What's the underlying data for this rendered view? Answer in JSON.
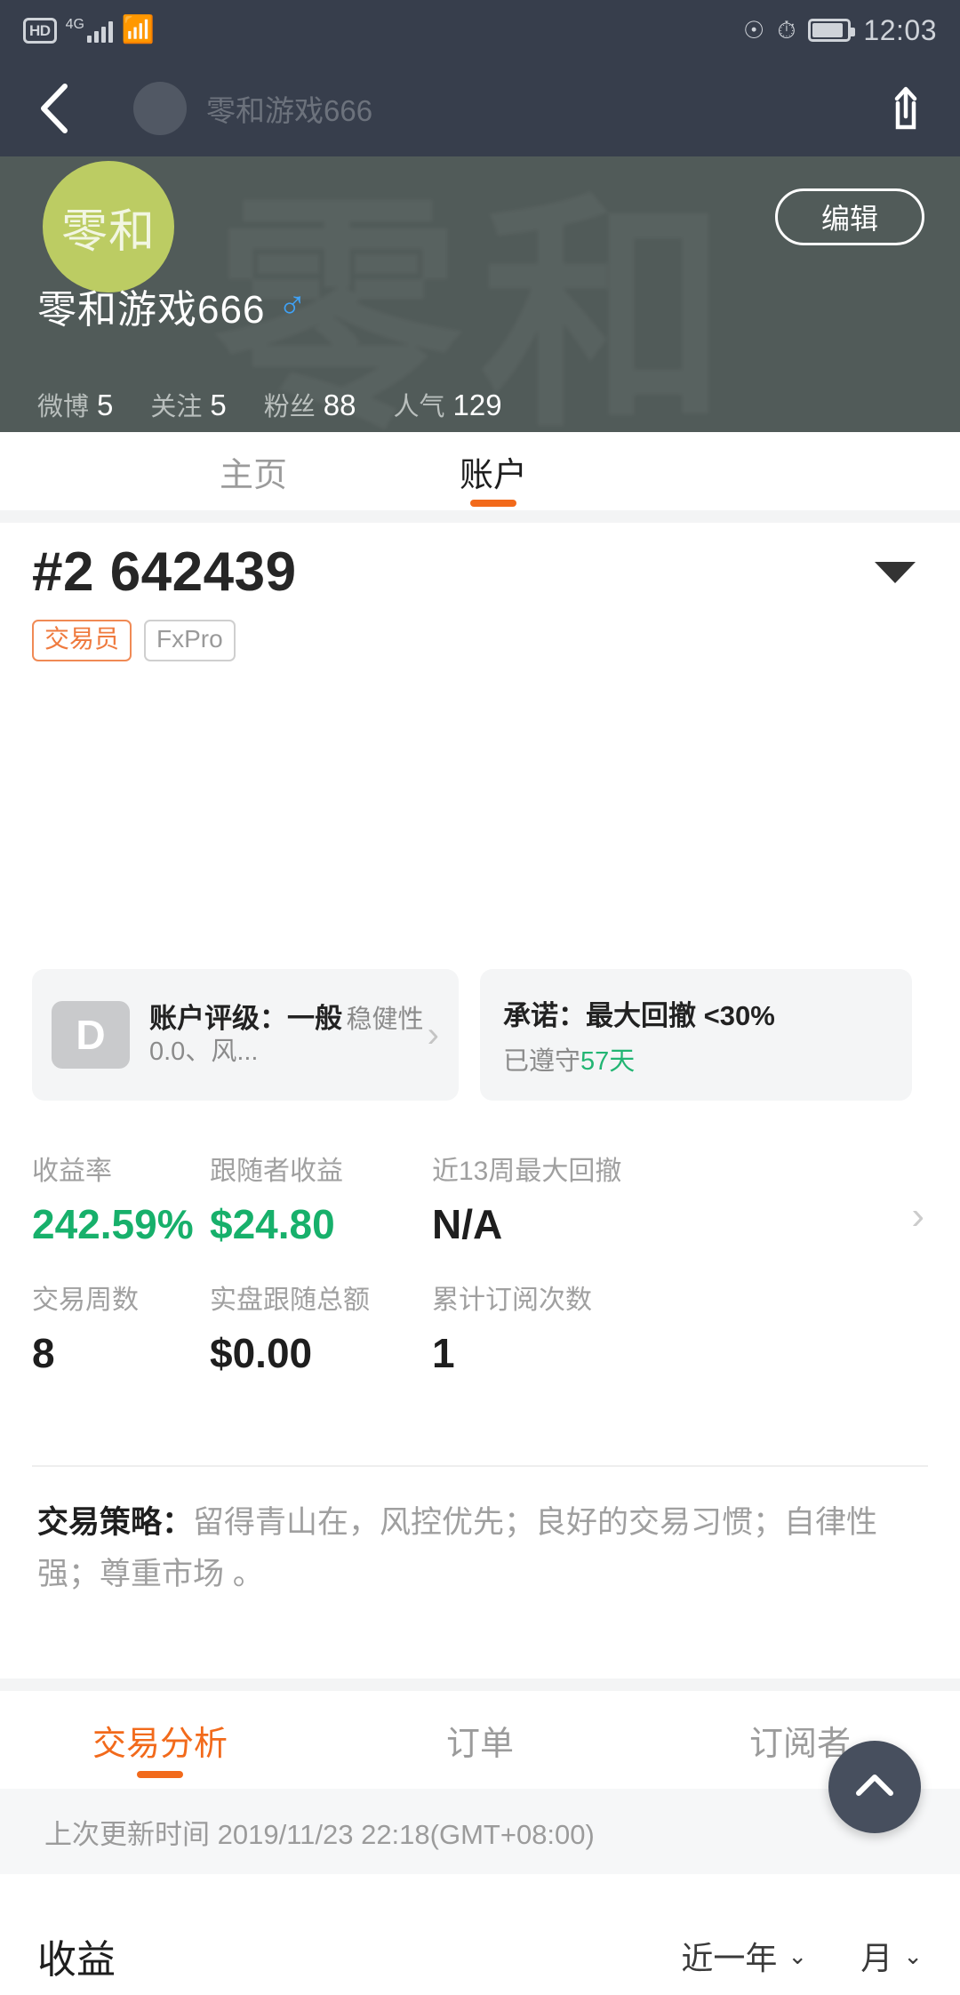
{
  "status_bar": {
    "hd_label": "HD",
    "network_type": "4G",
    "signal_icon": "signal-bars-icon",
    "wifi_icon": "wifi-icon",
    "eye_icon": "eye-protect-icon",
    "speed_icon": "network-speed-icon",
    "battery_icon": "battery-icon",
    "time": "12:03"
  },
  "nav_bar": {
    "back_icon": "back-chevron-icon",
    "ghost_title": "零和游戏666",
    "share_icon": "share-icon"
  },
  "profile": {
    "watermark": "零和",
    "avatar_text": "零和",
    "avatar_color": "#bccc63",
    "edit_label": "编辑",
    "username": "零和游戏666",
    "gender_icon": "male-gender-icon",
    "gender_glyph": "♂",
    "gender_color": "#3fa2f7",
    "stats": [
      {
        "label": "微博",
        "value": "5"
      },
      {
        "label": "关注",
        "value": "5"
      },
      {
        "label": "粉丝",
        "value": "88"
      },
      {
        "label": "人气",
        "value": "129"
      }
    ]
  },
  "main_tabs": {
    "accent_color": "#f26a1b",
    "items": [
      {
        "label": "主页",
        "active": false
      },
      {
        "label": "账户",
        "active": true
      }
    ]
  },
  "account": {
    "number": "#2 642439",
    "dropdown_icon": "caret-down-icon",
    "badges": [
      {
        "label": "交易员",
        "style": "trader"
      },
      {
        "label": "FxPro",
        "style": "broker"
      }
    ]
  },
  "cards": {
    "rating": {
      "grade": "D",
      "title": "账户评级：一般",
      "subtitle": "稳健性0.0、风...",
      "chevron_icon": "chevron-right-icon"
    },
    "promise": {
      "title": "承诺：最大回撤 <30%",
      "sub_prefix": "已遵守",
      "sub_highlight": "57天",
      "highlight_color": "#22b573"
    }
  },
  "metrics": {
    "chevron_icon": "chevron-right-icon",
    "row1": [
      {
        "label": "收益率",
        "value": "242.59%",
        "color": "green"
      },
      {
        "label": "跟随者收益",
        "value": "$24.80",
        "color": "green"
      },
      {
        "label": "近13周最大回撤",
        "value": "N/A",
        "color": "plain"
      }
    ],
    "row2": [
      {
        "label": "交易周数",
        "value": "8",
        "color": "plain"
      },
      {
        "label": "实盘跟随总额",
        "value": "$0.00",
        "color": "plain"
      },
      {
        "label": "累计订阅次数",
        "value": "1",
        "color": "plain"
      }
    ]
  },
  "strategy": {
    "label": "交易策略：",
    "text": "留得青山在，风控优先；良好的交易习惯；自律性强；尊重市场 。"
  },
  "secondary_tabs": {
    "items": [
      {
        "label": "交易分析",
        "active": true
      },
      {
        "label": "订单",
        "active": false
      },
      {
        "label": "订阅者",
        "active": false
      }
    ]
  },
  "update_bar": {
    "text": "上次更新时间 2019/11/23 22:18(GMT+08:00)"
  },
  "fab": {
    "icon": "chevron-up-icon"
  },
  "profit_section": {
    "title": "收益",
    "range_selector": {
      "label": "近一年",
      "icon": "chevron-down-icon"
    },
    "period_selector": {
      "label": "月",
      "icon": "chevron-down-icon"
    }
  }
}
